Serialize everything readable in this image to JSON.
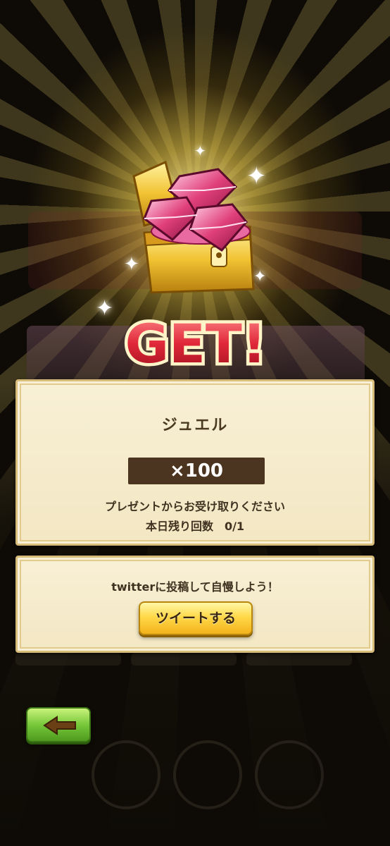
{
  "get_banner": {
    "text": "GET!"
  },
  "reward": {
    "name": "ジュエル",
    "amount": "×100",
    "note": "プレゼントからお受け取りください",
    "remaining": "本日残り回数　0/1"
  },
  "share": {
    "prompt": "twitterに投稿して自慢しよう！",
    "tweet_button_label": "ツイートする"
  },
  "icons": {
    "chest": "treasure-chest-with-jewels-icon",
    "back": "back-arrow-icon"
  },
  "colors": {
    "panel_bg": "#f6edcf",
    "panel_border": "#d8bc79",
    "amount_box": "#4b3520",
    "tweet_button": "#ffd94a",
    "back_button": "#77c83a",
    "get_text": "#e0283a"
  }
}
